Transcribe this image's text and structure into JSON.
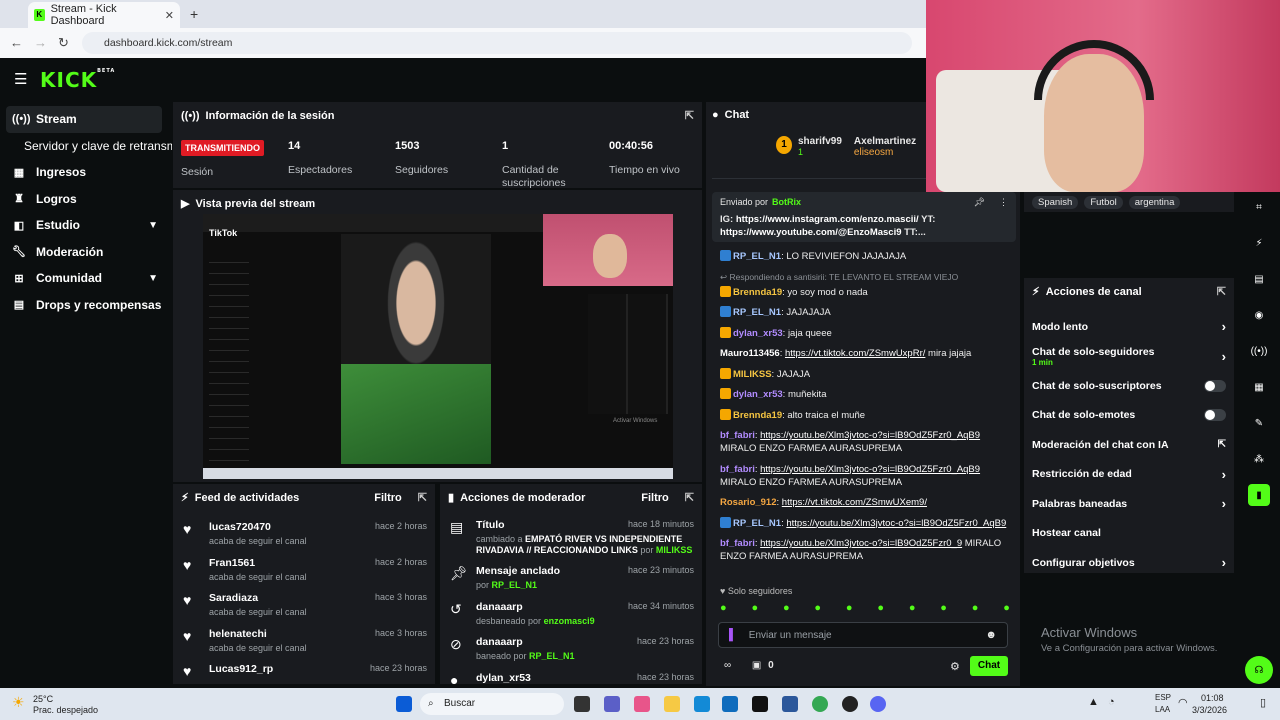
{
  "browser": {
    "tab_title": "Stream - Kick Dashboard",
    "tab_close": "✕",
    "new_tab": "+",
    "url": "dashboard.kick.com/stream"
  },
  "header": {
    "logo": "KICK",
    "logo_beta": "BETA"
  },
  "sidebar": {
    "items": [
      {
        "label": "Stream",
        "icon": "broadcast-icon"
      },
      {
        "label": "Servidor y clave de retransmisión"
      },
      {
        "label": "Ingresos",
        "icon": "money-icon"
      },
      {
        "label": "Logros",
        "icon": "trophy-icon"
      },
      {
        "label": "Estudio",
        "icon": "studio-icon"
      },
      {
        "label": "Moderación",
        "icon": "wrench-icon"
      },
      {
        "label": "Comunidad",
        "icon": "community-icon"
      },
      {
        "label": "Drops y recompensas",
        "icon": "drops-icon"
      }
    ]
  },
  "session": {
    "title": "Información de la sesión",
    "live_badge": "TRANSMITIENDO",
    "session_label": "Sesión",
    "stats": [
      {
        "value": "14",
        "label": "Espectadores"
      },
      {
        "value": "1503",
        "label": "Seguidores"
      },
      {
        "value": "1",
        "label": "Cantidad de suscripciones"
      },
      {
        "value": "00:40:56",
        "label": "Tiempo en vivo"
      }
    ]
  },
  "preview": {
    "title": "Vista previa del stream",
    "tiktok_label": "TikTok",
    "activate_text": "Activar Windows"
  },
  "activity_feed": {
    "title": "Feed de actividades",
    "filter": "Filtro",
    "rows": [
      {
        "name": "lucas720470",
        "action": "acaba de seguir el canal",
        "time": "hace 2 horas"
      },
      {
        "name": "Fran1561",
        "action": "acaba de seguir el canal",
        "time": "hace 2 horas"
      },
      {
        "name": "Saradiaza",
        "action": "acaba de seguir el canal",
        "time": "hace 3 horas"
      },
      {
        "name": "helenatechi",
        "action": "acaba de seguir el canal",
        "time": "hace 3 horas"
      },
      {
        "name": "Lucas912_rp",
        "action": "",
        "time": "hace 23 horas"
      }
    ]
  },
  "mod_actions": {
    "title": "Acciones de moderador",
    "filter": "Filtro",
    "rows": [
      {
        "title": "Título",
        "time": "hace 18 minutos",
        "detail_a": "cambiado a ",
        "detail_b": "EMPATÓ RIVER VS INDEPENDIENTE RIVADAVIA // REACCIONANDO LINKS",
        "detail_c": " por ",
        "who": "MILIKSS"
      },
      {
        "title": "Mensaje anclado",
        "time": "hace 23 minutos",
        "detail_a": "por ",
        "who": "RP_EL_N1"
      },
      {
        "title": "danaaarp",
        "time": "hace 34 minutos",
        "detail_a": "desbaneado por ",
        "who": "enzomasci9"
      },
      {
        "title": "danaaarp",
        "time": "hace 23 horas",
        "detail_a": "baneado por ",
        "who": "RP_EL_N1"
      },
      {
        "title": "dylan_xr53",
        "time": "hace 23 horas"
      }
    ]
  },
  "chat": {
    "title": "Chat",
    "top_gifters": [
      {
        "rank": "1",
        "name": "sharifv99",
        "count": "1"
      },
      {
        "name": "Axelmartinez"
      },
      {
        "name": "eliseosm"
      }
    ],
    "pinned": {
      "sent_by_label": "Enviado por",
      "sent_by": "BotRix",
      "text_a": "IG: ",
      "link_a": "https://www.instagram.com/enzo.mascii/",
      "text_b": " YT: ",
      "link_b": "https://www.youtube.com/@EnzoMasci9",
      "text_c": " TT:..."
    },
    "messages": [
      {
        "user": "RP_EL_N1",
        "color": "#a8c8ff",
        "text": "LO REVIVIEFON JAJAJAJA"
      },
      {
        "reply": "Respondiendo a santisirii: TE LEVANTO EL STREAM VIEJO"
      },
      {
        "user": "Brennda19",
        "color": "#f5c542",
        "text": "yo soy mod o nada"
      },
      {
        "user": "RP_EL_N1",
        "color": "#a8c8ff",
        "text": "JAJAJAJA"
      },
      {
        "user": "dylan_xr53",
        "color": "#b28cff",
        "text": "jaja queee"
      },
      {
        "user": "Mauro113456",
        "color": "#ffffff",
        "link": "https://vt.tiktok.com/ZSmwUxpRr/",
        "text": " mira jajaja"
      },
      {
        "user": "MILIKSS",
        "color": "#f5c542",
        "text": "JAJAJA"
      },
      {
        "user": "dylan_xr53",
        "color": "#b28cff",
        "text": "muñekita"
      },
      {
        "user": "Brennda19",
        "color": "#f5c542",
        "text": "alto traica el muñe"
      },
      {
        "user": "bf_fabri",
        "color": "#b28cff",
        "link": "https://youtu.be/Xlm3jvtoc-o?si=lB9OdZ5Fzr0_AqB9",
        "text": " MIRALO ENZO FARMEA AURASUPREMA"
      },
      {
        "user": "bf_fabri",
        "color": "#b28cff",
        "link": "https://youtu.be/Xlm3jvtoc-o?si=lB9OdZ5Fzr0_AqB9",
        "text": " MIRALO ENZO FARMEA AURASUPREMA"
      },
      {
        "user": "Rosario_912",
        "color": "#f5a742",
        "link": "https://vt.tiktok.com/ZSmwUXem9/",
        "text": ""
      },
      {
        "user": "RP_EL_N1",
        "color": "#a8c8ff",
        "link": "https://youtu.be/Xlm3jvtoc-o?si=lB9OdZ5Fzr0_AqB9",
        "text": ""
      },
      {
        "user": "bf_fabri",
        "color": "#b28cff",
        "link": "https://youtu.be/Xlm3jvtoc-o?si=lB9OdZ5Fzr0_9",
        "text": " MIRALO ENZO FARMEA AURASUPREMA"
      }
    ],
    "mode_label": "Solo seguidores",
    "input_placeholder": "Enviar un mensaje",
    "send_label": "Chat",
    "points": "0"
  },
  "channel_actions": {
    "title": "Acciones de canal",
    "tags": [
      "Spanish",
      "Futbol",
      "argentina"
    ],
    "items": [
      {
        "label": "Modo lento",
        "kind": "chevron"
      },
      {
        "label": "Chat de solo-seguidores",
        "sub": "1 min",
        "kind": "chevron"
      },
      {
        "label": "Chat de solo-suscriptores",
        "kind": "toggle"
      },
      {
        "label": "Chat de solo-emotes",
        "kind": "toggle"
      },
      {
        "label": "Moderación del chat con IA",
        "kind": "external"
      },
      {
        "label": "Restricción de edad",
        "kind": "chevron"
      },
      {
        "label": "Palabras baneadas",
        "kind": "chevron"
      },
      {
        "label": "Hostear canal",
        "kind": "none"
      },
      {
        "label": "Configurar objetivos",
        "kind": "chevron"
      }
    ]
  },
  "watermark": {
    "title": "Activar Windows",
    "sub": "Ve a Configuración para activar Windows."
  },
  "taskbar": {
    "temp": "25°C",
    "weather": "Prac. despejado",
    "search": "Buscar",
    "lang": "ESP",
    "lang2": "LAA",
    "time": "01:08",
    "date": "3/3/2026"
  }
}
